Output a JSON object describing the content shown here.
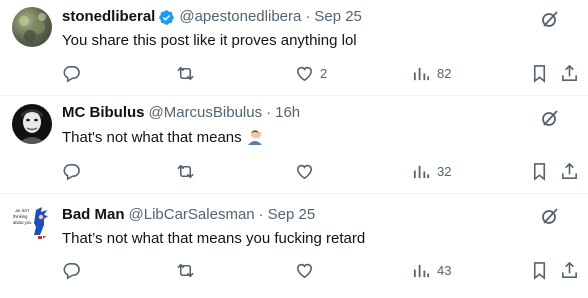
{
  "colors": {
    "text": "#0f1419",
    "secondary": "#536471",
    "verified": "#1d9bf0",
    "divider": "#eff3f4"
  },
  "tweets": [
    {
      "name": "stonedliberal",
      "verified": true,
      "handle": "@apestonedlibera",
      "time": "Sep 25",
      "text": "You share this post like it proves anything lol",
      "likes": "2",
      "views": "82"
    },
    {
      "name": "MC Bibulus",
      "handle": "@MarcusBibulus",
      "time": "16h",
      "text": "That's not what that means",
      "emoji": "man-facepalming-emoji",
      "views": "32"
    },
    {
      "name": "Bad Man",
      "handle": "@LibCarSalesman",
      "time": "Sep 25",
      "text": "That’s not what that means you fucking retard",
      "avatar_text": "She isn't thinking about you",
      "views": "43"
    }
  ],
  "separator": "·"
}
